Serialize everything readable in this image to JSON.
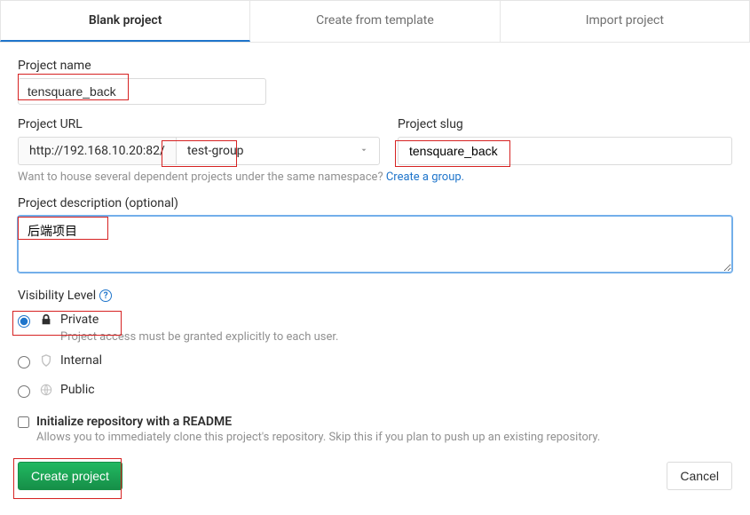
{
  "tabs": {
    "blank": "Blank project",
    "template": "Create from template",
    "import": "Import project"
  },
  "form": {
    "name_label": "Project name",
    "name_value": "tensquare_back",
    "url_label": "Project URL",
    "url_prefix": "http://192.168.10.20:82/",
    "url_namespace": "test-group",
    "slug_label": "Project slug",
    "slug_value": "tensquare_back",
    "namespace_hint": "Want to house several dependent projects under the same namespace? ",
    "namespace_link": "Create a group.",
    "desc_label": "Project description (optional)",
    "desc_value": "后端项目"
  },
  "visibility": {
    "label": "Visibility Level",
    "private": "Private",
    "private_desc": "Project access must be granted explicitly to each user.",
    "internal": "Internal",
    "public": "Public"
  },
  "readme": {
    "label": "Initialize repository with a README",
    "desc": "Allows you to immediately clone this project's repository. Skip this if you plan to push up an existing repository."
  },
  "actions": {
    "create": "Create project",
    "cancel": "Cancel"
  }
}
